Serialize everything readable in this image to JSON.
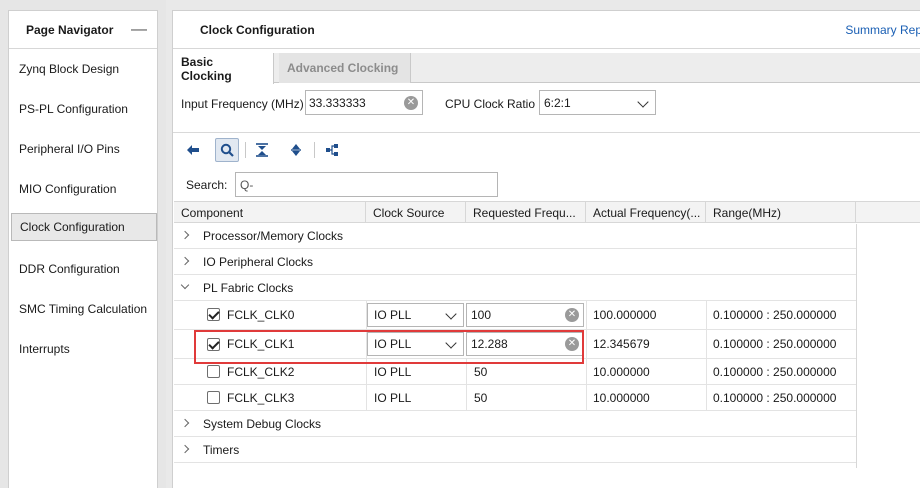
{
  "navigator": {
    "title": "Page Navigator",
    "minimize": "—",
    "items": [
      {
        "label": "Zynq Block Design"
      },
      {
        "label": "PS-PL Configuration"
      },
      {
        "label": "Peripheral I/O Pins"
      },
      {
        "label": "MIO Configuration"
      },
      {
        "label": "Clock Configuration",
        "selected": true
      },
      {
        "label": "DDR Configuration"
      },
      {
        "label": "SMC Timing Calculation"
      },
      {
        "label": "Interrupts"
      }
    ]
  },
  "main": {
    "title": "Clock Configuration",
    "summary_link": "Summary Rep",
    "tabs": [
      {
        "label": "Basic Clocking",
        "active": true
      },
      {
        "label": "Advanced Clocking",
        "active": false
      }
    ],
    "input_frequency": {
      "label": "Input Frequency (MHz)",
      "value": "33.333333"
    },
    "cpu_clock_ratio": {
      "label": "CPU Clock Ratio",
      "value": "6:2:1"
    },
    "search": {
      "label": "Search:",
      "placeholder": "Q-"
    }
  },
  "table": {
    "columns": [
      "Component",
      "Clock Source",
      "Requested Frequ...",
      "Actual Frequency(...",
      "Range(MHz)"
    ],
    "groups": {
      "processor_memory": "Processor/Memory Clocks",
      "io_peripheral": "IO Peripheral Clocks",
      "pl_fabric": "PL Fabric Clocks",
      "system_debug": "System Debug Clocks",
      "timers": "Timers"
    },
    "fclk": [
      {
        "name": "FCLK_CLK0",
        "checked": true,
        "source": "IO PLL",
        "requested": "100",
        "actual": "100.000000",
        "range": "0.100000 : 250.000000",
        "editable": true
      },
      {
        "name": "FCLK_CLK1",
        "checked": true,
        "source": "IO PLL",
        "requested": "12.288",
        "actual": "12.345679",
        "range": "0.100000 : 250.000000",
        "editable": true
      },
      {
        "name": "FCLK_CLK2",
        "checked": false,
        "source": "IO PLL",
        "requested": "50",
        "actual": "10.000000",
        "range": "0.100000 : 250.000000",
        "editable": false
      },
      {
        "name": "FCLK_CLK3",
        "checked": false,
        "source": "IO PLL",
        "requested": "50",
        "actual": "10.000000",
        "range": "0.100000 : 250.000000",
        "editable": false
      }
    ]
  },
  "colors": {
    "accent": "#1f4e8c",
    "highlight": "#e03a3a",
    "link": "#1a5fb4"
  },
  "icons": [
    "back-arrow-icon",
    "search-icon",
    "collapse-all-icon",
    "expand-all-icon",
    "hierarchy-icon",
    "clear-icon",
    "chevron-down-icon",
    "checkbox-icon"
  ]
}
